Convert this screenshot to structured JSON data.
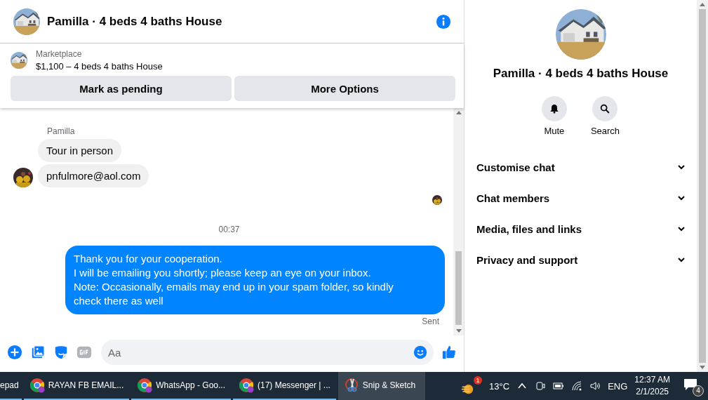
{
  "chat": {
    "title": "Pamilla · 4 beds 4 baths House",
    "listing": {
      "label": "Marketplace",
      "title": "$1,100 – 4 beds 4 baths House",
      "actions": [
        "Mark as pending",
        "More Options"
      ]
    },
    "messages": [
      {
        "kind": "sender",
        "text": "Pamilla"
      },
      {
        "kind": "incoming",
        "text": "Tour in person",
        "avatar": false
      },
      {
        "kind": "incoming",
        "text": "pnfulmore@aol.com",
        "avatar": true
      },
      {
        "kind": "seen"
      },
      {
        "kind": "timestamp",
        "text": "00:37"
      },
      {
        "kind": "outgoing",
        "text": "Thank you for your cooperation.\nI will be emailing you shortly; please keep an eye on your inbox.\nNote: Occasionally, emails may end up in your spam folder, so kindly\ncheck there as well"
      },
      {
        "kind": "status",
        "text": "Sent"
      }
    ],
    "composer": {
      "placeholder": "Aa"
    }
  },
  "details": {
    "title": "Pamilla · 4 beds 4 baths House",
    "actions": [
      {
        "kind": "mute",
        "label": "Mute"
      },
      {
        "kind": "search",
        "label": "Search"
      }
    ],
    "sections": [
      {
        "label": "Customise chat",
        "expanded": false
      },
      {
        "label": "Chat members",
        "expanded": false
      },
      {
        "label": "Media, files and links",
        "expanded": false
      },
      {
        "label": "Privacy and support",
        "expanded": false
      }
    ]
  },
  "taskbar": {
    "apps": [
      {
        "kind": "plain",
        "label": "epad",
        "selected": false
      },
      {
        "kind": "browser",
        "label": "RAYAN FB EMAIL...",
        "selected": false
      },
      {
        "kind": "browser",
        "label": "WhatsApp - Goo...",
        "selected": false
      },
      {
        "kind": "browser",
        "label": "(17) Messenger | ...",
        "selected": false
      },
      {
        "kind": "snip",
        "label": "Snip & Sketch",
        "selected": true
      }
    ],
    "weather": {
      "badge": "1",
      "temperature": "13°C"
    },
    "language": "ENG",
    "time": "12:37 AM",
    "date": "2/1/2025",
    "notifications": "4"
  }
}
